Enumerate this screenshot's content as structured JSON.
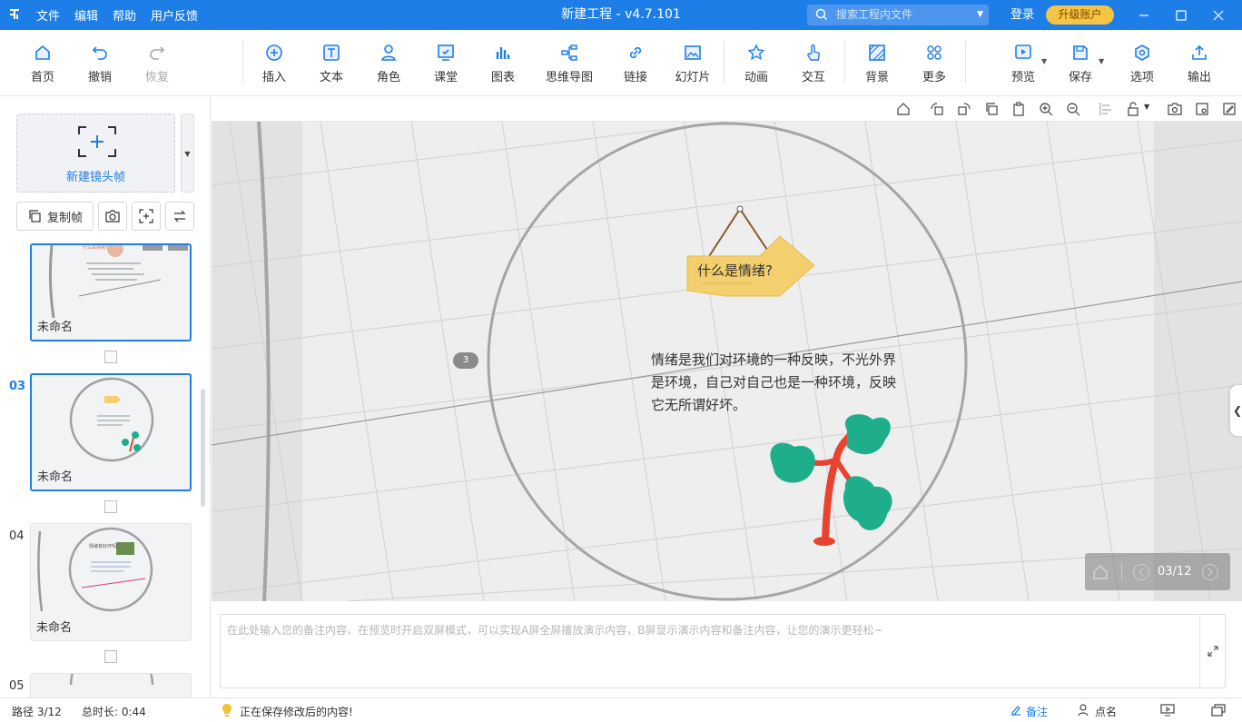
{
  "menu": {
    "file": "文件",
    "edit": "编辑",
    "help": "帮助",
    "feedback": "用户反馈"
  },
  "app_title": "新建工程 - v4.7.101",
  "search": {
    "placeholder": "搜索工程内文件"
  },
  "account": {
    "login": "登录",
    "upgrade": "升级账户"
  },
  "toolbar": {
    "home": "首页",
    "undo": "撤销",
    "redo": "恢复",
    "insert": "插入",
    "text": "文本",
    "role": "角色",
    "classroom": "课堂",
    "chart": "图表",
    "mindmap": "思维导图",
    "link": "链接",
    "slideshow": "幻灯片",
    "animation": "动画",
    "interact": "交互",
    "background": "背景",
    "more": "更多",
    "preview": "预览",
    "save": "保存",
    "options": "选项",
    "export": "输出"
  },
  "left": {
    "new_frame": "新建镜头帧",
    "copy_frame": "复制帧",
    "frames": [
      {
        "num": "",
        "label": "未命名",
        "text": "什么是情绪?"
      },
      {
        "num": "03",
        "label": "未命名"
      },
      {
        "num": "04",
        "label": "未命名",
        "text": "情绪有好坏吗?"
      },
      {
        "num": "05",
        "label": ""
      }
    ]
  },
  "canvas": {
    "sign_text": "什么是情绪?",
    "body_text_lines": [
      "情绪是我们对环境的一种反映，不光外界",
      "是环境，自己对自己也是一种环境，反映",
      "它无所谓好坏。"
    ],
    "frame_badge": "3",
    "pager": "03/12"
  },
  "notes": {
    "placeholder": "在此处输入您的备注内容，在预览时开启双屏模式，可以实现A屏全屏播放演示内容，B屏显示演示内容和备注内容，让您的演示更轻松~"
  },
  "status": {
    "path": "路径 3/12",
    "duration": "总时长: 0:44",
    "saving": "正在保存修改后的内容!",
    "notes": "备注",
    "rollcall": "点名"
  },
  "colors": {
    "accent": "#1e7ee8",
    "upgrade": "#f7c443",
    "leaf": "#1fae8c",
    "trunk": "#e8432e",
    "sign": "#f3cf6d"
  }
}
